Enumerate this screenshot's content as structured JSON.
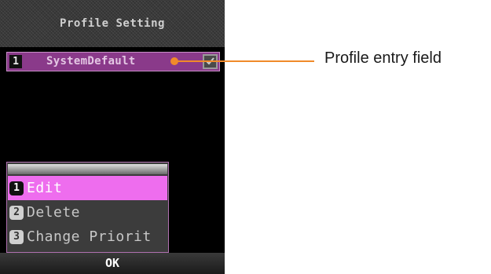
{
  "screen": {
    "title": "Profile Setting",
    "profile_entry": {
      "number": "1",
      "name": "SystemDefault",
      "checked": true
    },
    "context_menu": {
      "items": [
        {
          "number": "1",
          "label": "Edit",
          "selected": true
        },
        {
          "number": "2",
          "label": "Delete",
          "selected": false
        },
        {
          "number": "3",
          "label": "Change Priorit",
          "selected": false
        }
      ]
    },
    "softkey": {
      "center": "OK"
    }
  },
  "annotation": {
    "label": "Profile entry field",
    "color": "#f08a2a"
  },
  "colors": {
    "selected_item": "#ee6dee",
    "profile_row": "#8a3a8a"
  },
  "icons": {
    "checkbox": "check-icon"
  }
}
